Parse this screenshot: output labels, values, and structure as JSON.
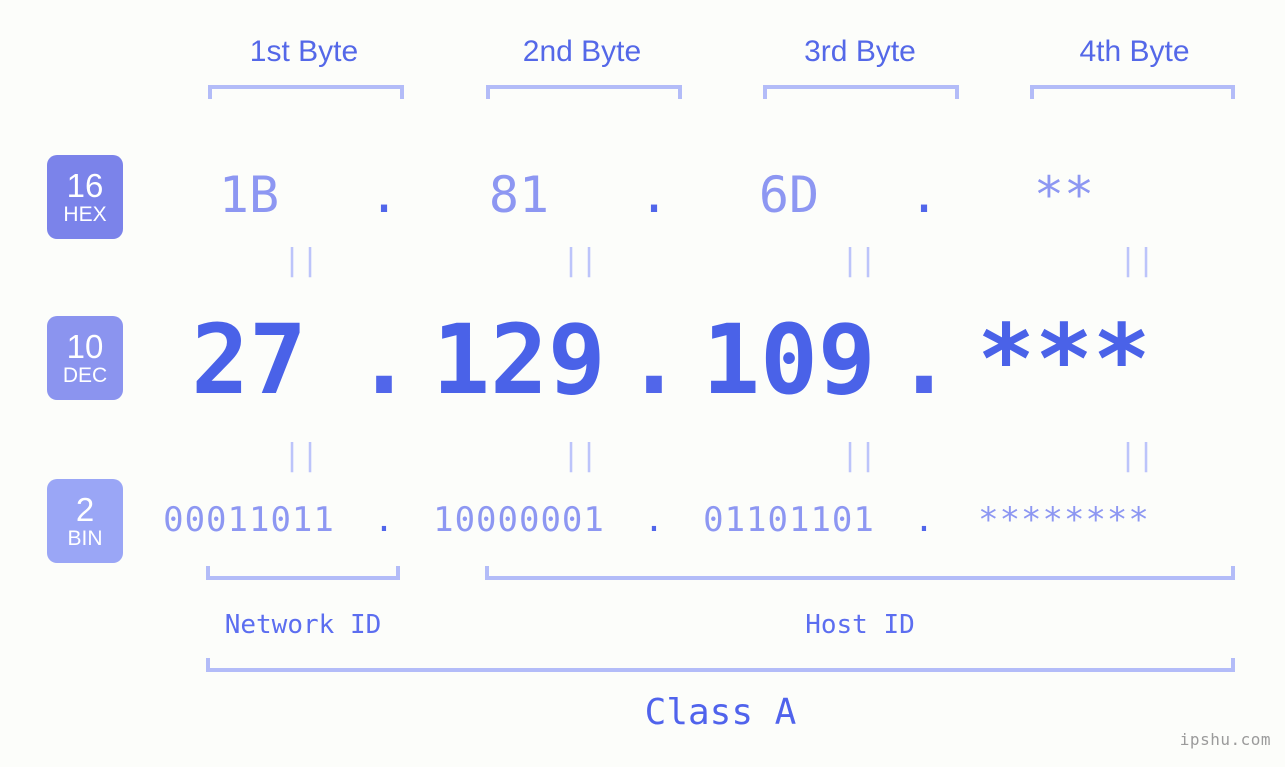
{
  "background_color": "#fcfdfa",
  "accent_colors": {
    "header_blue": "#5468e8",
    "bracket_blue": "#b3bcf8",
    "light_value_blue": "#8d97f2",
    "strong_value_blue": "#4a62e8",
    "separator_blue": "#5166ea",
    "equals_blue": "#bcc4fa",
    "badge_hex": "#7b83ea",
    "badge_dec": "#8b94ef",
    "badge_bin": "#9aa6f6",
    "watermark_gray": "#9b9b9b"
  },
  "byte_headers": [
    {
      "label": "1st Byte"
    },
    {
      "label": "2nd Byte"
    },
    {
      "label": "3rd Byte"
    },
    {
      "label": "4th Byte"
    }
  ],
  "bases": [
    {
      "number": "16",
      "name": "HEX"
    },
    {
      "number": "10",
      "name": "DEC"
    },
    {
      "number": "2",
      "name": "BIN"
    }
  ],
  "separator": ".",
  "equals_mark": "||",
  "rows": {
    "hex": {
      "base_number": "16",
      "base_name": "HEX",
      "values": [
        "1B",
        "81",
        "6D",
        "**"
      ]
    },
    "dec": {
      "base_number": "10",
      "base_name": "DEC",
      "values": [
        "27",
        "129",
        "109",
        "***"
      ]
    },
    "bin": {
      "base_number": "2",
      "base_name": "BIN",
      "values": [
        "00011011",
        "10000001",
        "01101101",
        "********"
      ]
    }
  },
  "regions": {
    "network_id": "Network ID",
    "host_id": "Host ID",
    "class": "Class A"
  },
  "watermark": "ipshu.com"
}
